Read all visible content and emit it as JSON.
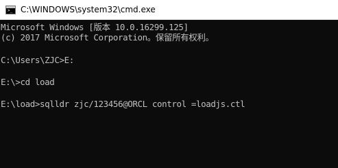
{
  "window": {
    "title": "C:\\WINDOWS\\system32\\cmd.exe",
    "icon": "console-icon"
  },
  "console": {
    "lines": [
      "Microsoft Windows [版本 10.0.16299.125]",
      "(c) 2017 Microsoft Corporation。保留所有权利。",
      "C:\\Users\\ZJC>E:",
      "E:\\>cd load",
      "E:\\load>sqlldr zjc/123456@ORCL control =loadjs.ctl"
    ]
  },
  "colors": {
    "console_background": "#0c0c0c",
    "console_text": "#c0c0c0",
    "titlebar_background": "#ffffff"
  }
}
